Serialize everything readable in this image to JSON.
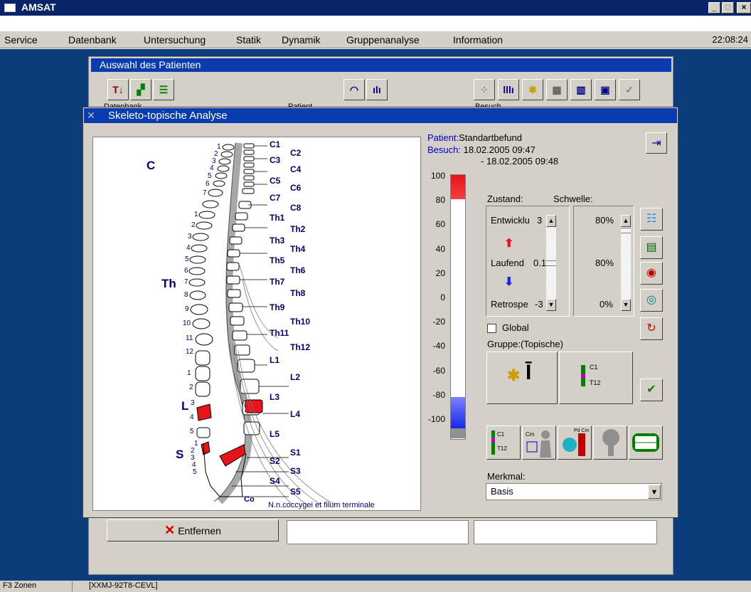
{
  "app": {
    "title": "AMSAT",
    "clock": "22:08:24",
    "min_label": "_",
    "max_label": "□",
    "close_label": "×"
  },
  "menu": {
    "items": [
      "Service",
      "Datenbank",
      "Untersuchung",
      "Statik",
      "Dynamik",
      "Gruppenanalyse",
      "Information"
    ]
  },
  "statusbar": {
    "left": "F3 Zonen",
    "right": "[XXMJ-92T8-CEVL]"
  },
  "background_window": {
    "title": "Auswahl des Patienten",
    "labels": {
      "datenbank": "Datenbank",
      "patient": "Patient",
      "besuch": "Besuch"
    },
    "remove_button": "Entfernen"
  },
  "dialog": {
    "title": "Skeleto-topische Analyse",
    "patient_label": "Patient:",
    "patient_value": "Standartbefund",
    "besuch_label": "Besuch:",
    "besuch_from": "18.02.2005 09:47",
    "besuch_to": "- 18.02.2005 09:48",
    "zustand_label": "Zustand:",
    "schwelle_label": "Schwelle:",
    "entwicklung_label": "Entwicklu",
    "entwicklung_value": "3",
    "laufend_label": "Laufend",
    "laufend_value": "0.1",
    "retrospe_label": "Retrospe",
    "retrospe_value": "-3",
    "schwelle_top": "80%",
    "schwelle_mid": "80%",
    "schwelle_bottom": "0%",
    "global_label": "Global",
    "gruppe_label": "Gruppe:(Topische)",
    "merkmal_label": "Merkmal:",
    "merkmal_value": "Basis",
    "spine_footer": "N.n.coccygei et filum terminale"
  },
  "scale": {
    "ticks": [
      "100",
      "80",
      "60",
      "40",
      "20",
      "0",
      "-20",
      "-40",
      "-60",
      "-80",
      "-100"
    ]
  },
  "spine": {
    "regions": {
      "cervical": "C",
      "thoracic": "Th",
      "lumbar": "L",
      "sacral": "S"
    },
    "right_labels": [
      "C1",
      "C2",
      "C3",
      "C4",
      "C5",
      "C6",
      "C7",
      "C8",
      "Th1",
      "Th2",
      "Th3",
      "Th4",
      "Th5",
      "Th6",
      "Th7",
      "Th8",
      "Th9",
      "Th10",
      "Th11",
      "Th12",
      "L1",
      "L2",
      "L3",
      "L4",
      "L5",
      "S1",
      "S2",
      "S3",
      "S4",
      "S5",
      "Co"
    ],
    "cervical_nums": [
      "1",
      "2",
      "3",
      "4",
      "5",
      "6",
      "7"
    ],
    "thoracic_nums": [
      "1",
      "2",
      "3",
      "4",
      "5",
      "6",
      "7",
      "8",
      "9",
      "10",
      "11",
      "12"
    ],
    "lumbar_nums": [
      "1",
      "2",
      "3",
      "4",
      "5"
    ],
    "sacral_nums": [
      "1",
      "2",
      "3",
      "4",
      "5"
    ],
    "highlight_color": "#e8141a"
  },
  "colors": {
    "accent": "#0a3cb0",
    "scale_red": "#e8141a",
    "scale_blue": "#1428e8"
  }
}
